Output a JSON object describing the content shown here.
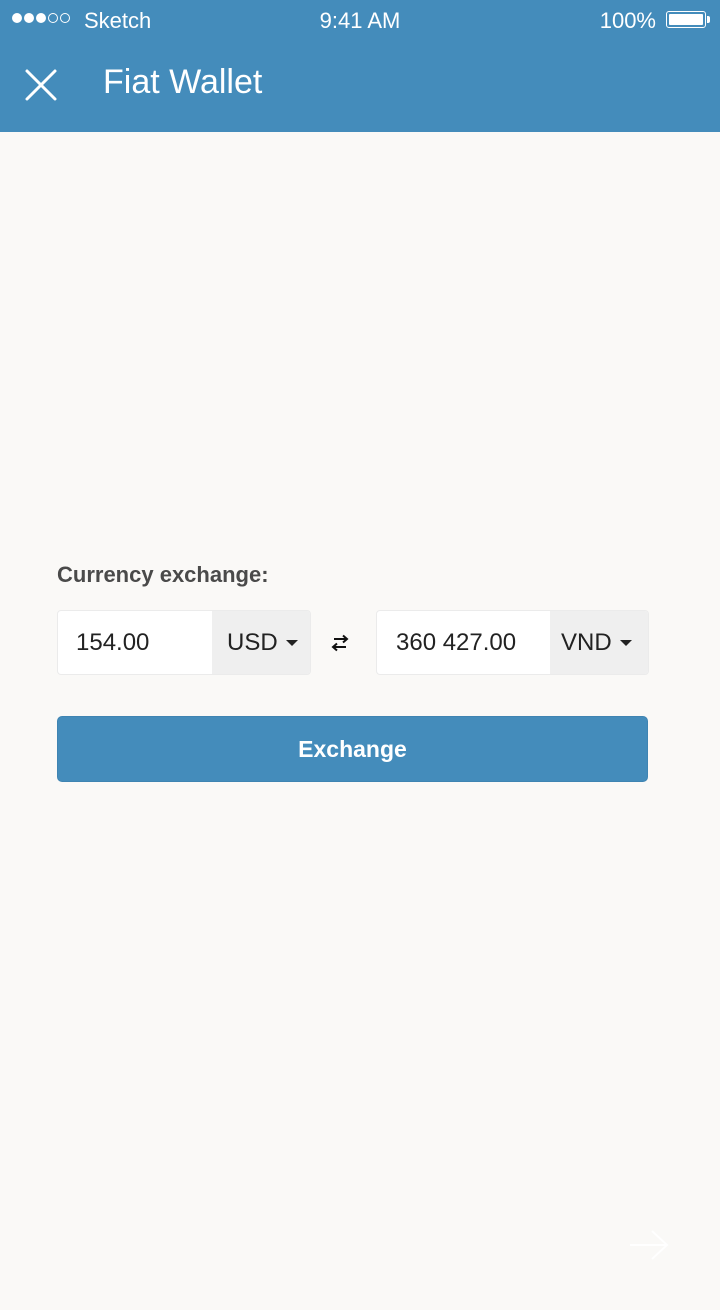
{
  "status_bar": {
    "carrier": "Sketch",
    "time": "9:41 AM",
    "battery_percent": "100%",
    "signal_strength": 3,
    "signal_max": 5
  },
  "header": {
    "title": "Fiat Wallet",
    "close_icon": "close-icon"
  },
  "exchange_form": {
    "label": "Currency exchange:",
    "from": {
      "amount": "154.00",
      "currency": "USD"
    },
    "to": {
      "amount": "360 427.00",
      "currency": "VND"
    },
    "swap_icon": "swap-arrows-icon",
    "submit_label": "Exchange"
  },
  "footer": {
    "next_icon": "arrow-right-icon"
  },
  "colors": {
    "accent": "#448cbb",
    "background": "#faf9f7",
    "select_bg": "#efefef",
    "label_text": "#4a4a4a"
  }
}
